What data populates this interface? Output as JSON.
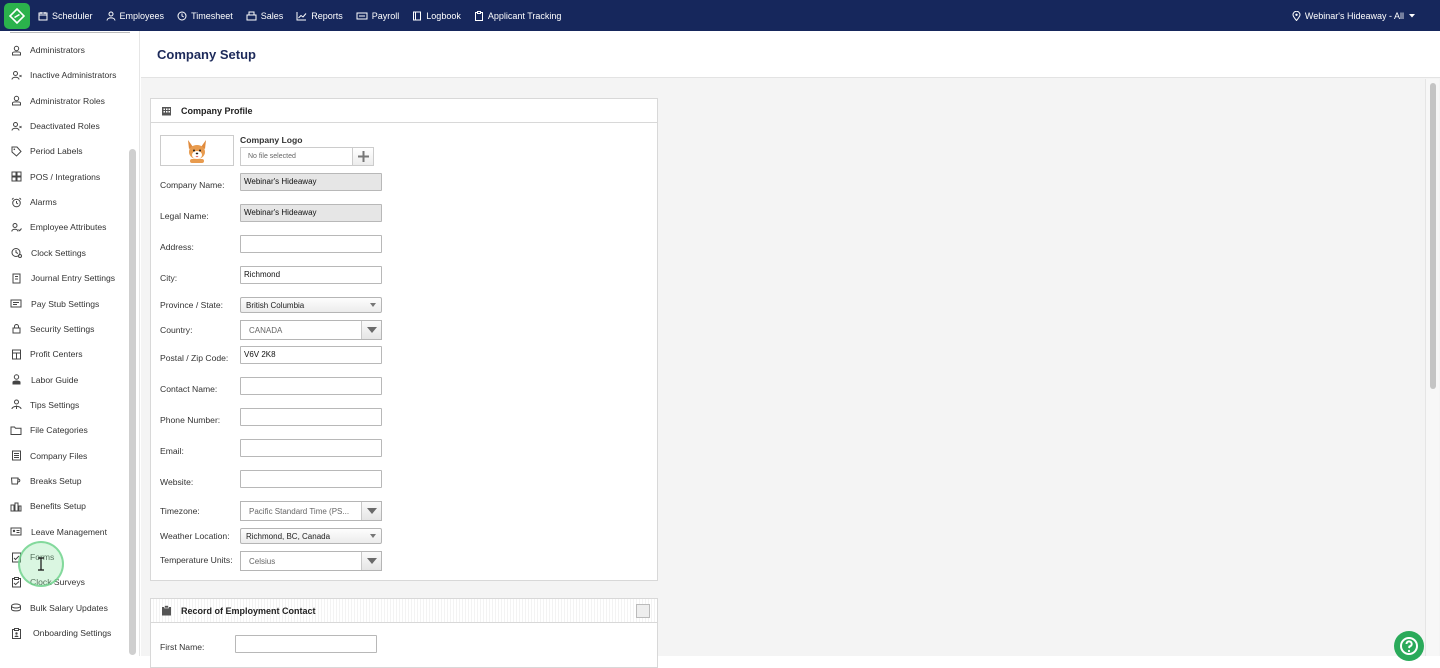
{
  "topnav": {
    "items": [
      {
        "label": "Scheduler",
        "icon": "calendar-icon"
      },
      {
        "label": "Employees",
        "icon": "person-icon"
      },
      {
        "label": "Timesheet",
        "icon": "clock-icon"
      },
      {
        "label": "Sales",
        "icon": "register-icon"
      },
      {
        "label": "Reports",
        "icon": "chart-icon"
      },
      {
        "label": "Payroll",
        "icon": "payroll-icon"
      },
      {
        "label": "Logbook",
        "icon": "book-icon"
      },
      {
        "label": "Applicant Tracking",
        "icon": "clipboard-icon"
      }
    ],
    "location": "Webinar's Hideaway - All",
    "brand_color": "#16275c",
    "logo_color": "#2bb24c"
  },
  "sidebar": {
    "items": [
      {
        "label": "Administrators"
      },
      {
        "label": "Inactive Administrators"
      },
      {
        "label": "Administrator Roles"
      },
      {
        "label": "Deactivated Roles"
      },
      {
        "label": "Period Labels"
      },
      {
        "label": "POS / Integrations"
      },
      {
        "label": "Alarms"
      },
      {
        "label": "Employee Attributes"
      },
      {
        "label": "Clock Settings"
      },
      {
        "label": "Journal Entry Settings"
      },
      {
        "label": "Pay Stub Settings"
      },
      {
        "label": "Security Settings"
      },
      {
        "label": "Profit Centers"
      },
      {
        "label": "Labor Guide"
      },
      {
        "label": "Tips Settings"
      },
      {
        "label": "File Categories"
      },
      {
        "label": "Company Files"
      },
      {
        "label": "Breaks Setup"
      },
      {
        "label": "Benefits Setup"
      },
      {
        "label": "Leave Management"
      },
      {
        "label": "Forms"
      },
      {
        "label": "Clock Surveys"
      },
      {
        "label": "Bulk Salary Updates"
      },
      {
        "label": "Onboarding Settings"
      }
    ]
  },
  "page": {
    "title": "Company Setup"
  },
  "profile": {
    "title": "Company Profile",
    "logo_label": "Company Logo",
    "file_placeholder": "No file selected",
    "fields": {
      "company_name": {
        "label": "Company Name:",
        "value": "Webinar's Hideaway"
      },
      "legal_name": {
        "label": "Legal Name:",
        "value": "Webinar's Hideaway"
      },
      "address": {
        "label": "Address:",
        "value": ""
      },
      "city": {
        "label": "City:",
        "value": "Richmond"
      },
      "province": {
        "label": "Province / State:",
        "value": "British Columbia"
      },
      "country": {
        "label": "Country:",
        "value": "CANADA"
      },
      "postal": {
        "label": "Postal / Zip Code:",
        "value": "V6V 2K8"
      },
      "contact": {
        "label": "Contact Name:",
        "value": ""
      },
      "phone": {
        "label": "Phone Number:",
        "value": ""
      },
      "email": {
        "label": "Email:",
        "value": ""
      },
      "website": {
        "label": "Website:",
        "value": ""
      },
      "timezone": {
        "label": "Timezone:",
        "value": "Pacific Standard Time (PS..."
      },
      "weather": {
        "label": "Weather Location:",
        "value": "Richmond, BC, Canada"
      },
      "temperature": {
        "label": "Temperature Units:",
        "value": "Celsius"
      }
    }
  },
  "roe": {
    "title": "Record of Employment Contact",
    "first_name_label": "First Name:",
    "first_name_value": ""
  }
}
